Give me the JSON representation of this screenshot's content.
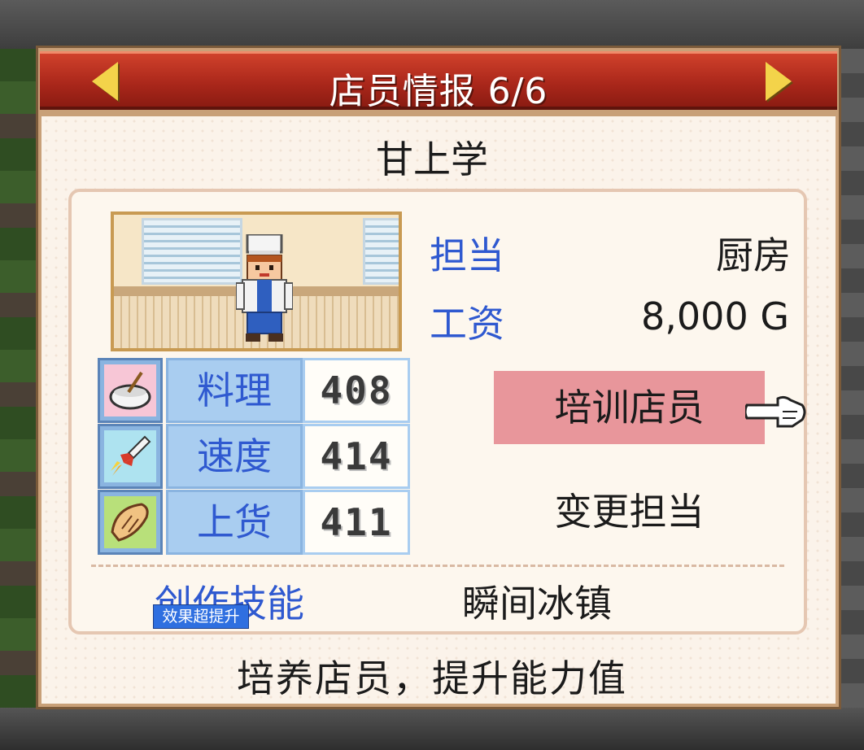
{
  "title": "店员情报 6/6",
  "staff": {
    "name": "甘上学"
  },
  "info": {
    "role_label": "担当",
    "role_value": "厨房",
    "salary_label": "工资",
    "salary_value": "8,000 G"
  },
  "stats": [
    {
      "label": "料理",
      "value": "408",
      "icon": "cooking-bowl-icon"
    },
    {
      "label": "速度",
      "value": "414",
      "icon": "rocket-icon"
    },
    {
      "label": "上货",
      "value": "411",
      "icon": "bread-icon"
    }
  ],
  "buttons": {
    "train": "培训店员",
    "change_role": "变更担当"
  },
  "skill": {
    "label": "创作技能",
    "badge": "效果超提升",
    "value": "瞬间冰镇"
  },
  "footer": "培养店员，提升能力值"
}
